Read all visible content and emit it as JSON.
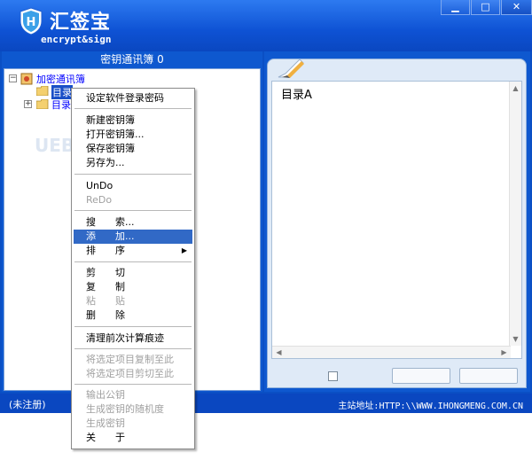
{
  "app": {
    "title": "汇签宝",
    "subtitle": "encrypt&sign",
    "window_controls": {
      "minimize": "▁",
      "maximize": "□",
      "close": "✕"
    }
  },
  "left_panel": {
    "title": "密钥通讯簿 0",
    "tree": {
      "root": {
        "expander": "−",
        "label": "加密通讯簿"
      },
      "items": [
        {
          "label": "目录",
          "selected": true,
          "expander": ""
        },
        {
          "label": "目录",
          "selected": false,
          "expander": "+"
        }
      ]
    },
    "watermark": "UEBU"
  },
  "right_panel": {
    "editor_text": "目录A",
    "scroll_arrows": {
      "up": "▲",
      "down": "▼",
      "left": "◀",
      "right": "▶"
    }
  },
  "status_bar": {
    "left": "(未注册)",
    "right": "主站地址:HTTP:\\\\WWW.IHONGMENG.COM.CN"
  },
  "context_menu": {
    "items": [
      {
        "label": "设定软件登录密码",
        "disabled": false
      },
      {
        "label": "新建密钥簿",
        "disabled": false
      },
      {
        "label": "打开密钥簿...",
        "disabled": false
      },
      {
        "label": "保存密钥簿",
        "disabled": false
      },
      {
        "label": "另存为...",
        "disabled": false
      },
      {
        "label": "UnDo",
        "disabled": false
      },
      {
        "label": "ReDo",
        "disabled": true
      },
      {
        "label": "搜　　索...",
        "disabled": false
      },
      {
        "label": "添　　加...",
        "disabled": false,
        "highlighted": true
      },
      {
        "label": "排　　序",
        "disabled": false,
        "submenu": "▶"
      },
      {
        "label": "剪　　切",
        "disabled": false
      },
      {
        "label": "复　　制",
        "disabled": false
      },
      {
        "label": "粘　　贴",
        "disabled": true
      },
      {
        "label": "删　　除",
        "disabled": false
      },
      {
        "label": "清理前次计算痕迹",
        "disabled": false
      },
      {
        "label": "将选定项目复制至此",
        "disabled": true
      },
      {
        "label": "将选定项目剪切至此",
        "disabled": true
      },
      {
        "label": "输出公钥",
        "disabled": true
      },
      {
        "label": "生成密钥的随机度",
        "disabled": true
      },
      {
        "label": "生成密钥",
        "disabled": true
      },
      {
        "label": "关　　于",
        "disabled": false
      }
    ]
  },
  "colors": {
    "frame_blue": "#0a4fc4",
    "menu_highlight": "#3169c6",
    "tree_link": "#0000ff",
    "disabled_text": "#a0a0a0"
  }
}
